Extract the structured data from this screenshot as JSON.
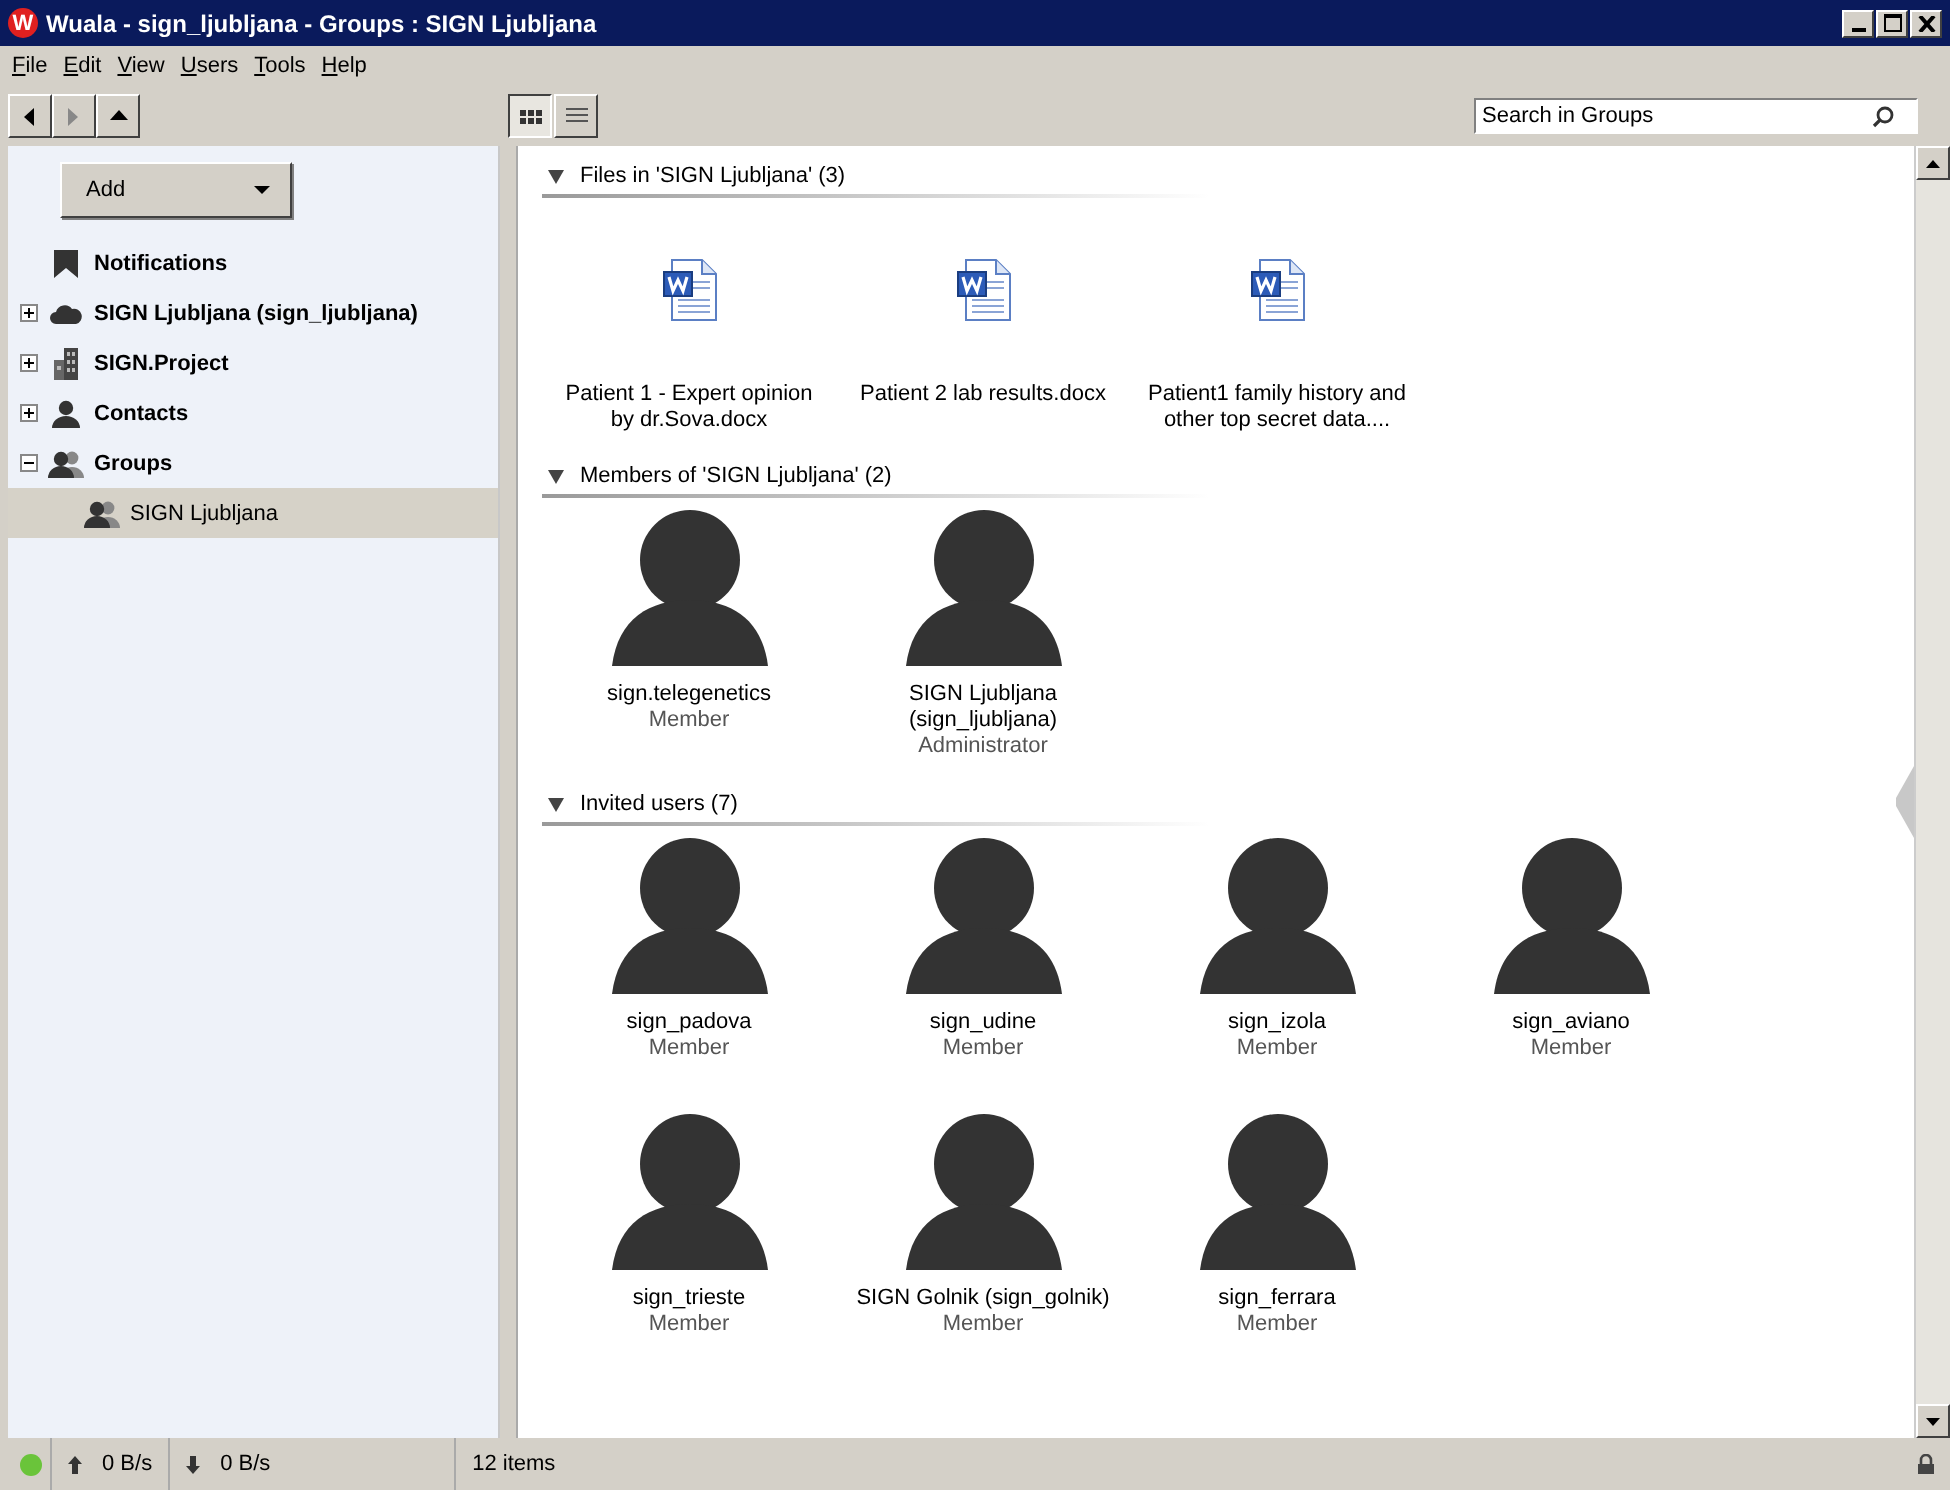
{
  "window": {
    "title": "Wuala - sign_ljubljana - Groups : SIGN Ljubljana",
    "app_badge": "W"
  },
  "menu": [
    "File",
    "Edit",
    "View",
    "Users",
    "Tools",
    "Help"
  ],
  "view_modes": [
    {
      "kind": "icons",
      "selected": true
    },
    {
      "kind": "list",
      "selected": false
    }
  ],
  "search": {
    "placeholder": "Search in Groups"
  },
  "sidebar": {
    "add_button": "Add",
    "items": [
      {
        "label": "Notifications",
        "kind": "bookmark"
      },
      {
        "label": "SIGN Ljubljana (sign_ljubljana)",
        "kind": "cloud",
        "expanded": false
      },
      {
        "label": "SIGN.Project",
        "kind": "building",
        "expanded": false
      },
      {
        "label": "Contacts",
        "kind": "person",
        "expanded": false
      },
      {
        "label": "Groups",
        "kind": "group",
        "expanded": true,
        "children": [
          {
            "label": "SIGN Ljubljana",
            "kind": "group",
            "selected": true
          }
        ]
      }
    ]
  },
  "sections": [
    {
      "title": "Files in 'SIGN Ljubljana' (3)",
      "expanded": true,
      "items": [
        {
          "kind": "file",
          "name": "Patient 1 - Expert opinion by dr.Sova.docx"
        },
        {
          "kind": "file",
          "name": "Patient 2 lab results.docx"
        },
        {
          "kind": "file",
          "name": "Patient1 family history and other top secret  data...."
        }
      ]
    },
    {
      "title": "Members of 'SIGN Ljubljana' (2)",
      "expanded": true,
      "items": [
        {
          "kind": "user",
          "name": "sign.telegenetics",
          "role": "Member"
        },
        {
          "kind": "user",
          "name": "SIGN Ljubljana (sign_ljubljana)",
          "role": "Administrator"
        }
      ]
    },
    {
      "title": "Invited users (7)",
      "expanded": true,
      "items": [
        {
          "kind": "user",
          "name": "sign_padova",
          "role": "Member"
        },
        {
          "kind": "user",
          "name": "sign_udine",
          "role": "Member"
        },
        {
          "kind": "user",
          "name": "sign_izola",
          "role": "Member"
        },
        {
          "kind": "user",
          "name": "sign_aviano",
          "role": "Member"
        },
        {
          "kind": "user",
          "name": "sign_trieste",
          "role": "Member"
        },
        {
          "kind": "user",
          "name": "SIGN Golnik (sign_golnik)",
          "role": "Member"
        },
        {
          "kind": "user",
          "name": "sign_ferrara",
          "role": "Member"
        }
      ]
    }
  ],
  "status_bar": {
    "connected": true,
    "upload": "0 B/s",
    "download": "0 B/s",
    "item_count": "12 items"
  }
}
